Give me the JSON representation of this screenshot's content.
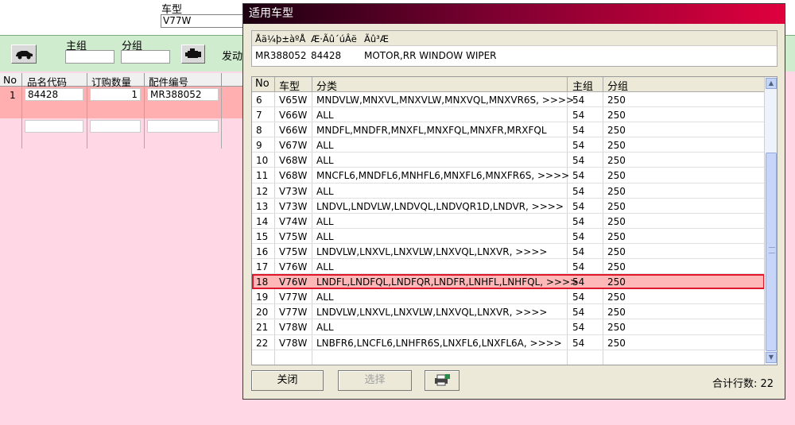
{
  "background": {
    "car_label": "车型",
    "car_value": "V77W",
    "main_group_label": "主组",
    "sub_group_label": "分组",
    "engine_label": "发动",
    "grid_headers": [
      "No",
      "品名代码",
      "订购数量",
      "配件编号"
    ],
    "grid_row": {
      "no": "1",
      "code": "84428",
      "qty": "1",
      "part": "MR388052"
    }
  },
  "window": {
    "title": "适用车型",
    "info_headers": [
      "Åä¼þ±àºÅ",
      "Æ·Ãû´úÂë",
      "Ãû³Æ"
    ],
    "info_values": [
      "MR388052",
      "84428",
      "MOTOR,RR WINDOW WIPER"
    ],
    "columns": [
      "No",
      "车型",
      "分类",
      "主组",
      "分组"
    ],
    "rows": [
      {
        "no": "6",
        "model": "V65W",
        "cls": "MNDVLW,MNXVL,MNXVLW,MNXVQL,MNXVR6S,  >>>>",
        "main": "54",
        "sub": "250"
      },
      {
        "no": "7",
        "model": "V66W",
        "cls": "ALL",
        "main": "54",
        "sub": "250"
      },
      {
        "no": "8",
        "model": "V66W",
        "cls": "MNDFL,MNDFR,MNXFL,MNXFQL,MNXFR,MRXFQL",
        "main": "54",
        "sub": "250"
      },
      {
        "no": "9",
        "model": "V67W",
        "cls": "ALL",
        "main": "54",
        "sub": "250"
      },
      {
        "no": "10",
        "model": "V68W",
        "cls": "ALL",
        "main": "54",
        "sub": "250"
      },
      {
        "no": "11",
        "model": "V68W",
        "cls": "MNCFL6,MNDFL6,MNHFL6,MNXFL6,MNXFR6S,  >>>>",
        "main": "54",
        "sub": "250"
      },
      {
        "no": "12",
        "model": "V73W",
        "cls": "ALL",
        "main": "54",
        "sub": "250"
      },
      {
        "no": "13",
        "model": "V73W",
        "cls": "LNDVL,LNDVLW,LNDVQL,LNDVQR1D,LNDVR,  >>>>",
        "main": "54",
        "sub": "250"
      },
      {
        "no": "14",
        "model": "V74W",
        "cls": "ALL",
        "main": "54",
        "sub": "250"
      },
      {
        "no": "15",
        "model": "V75W",
        "cls": "ALL",
        "main": "54",
        "sub": "250"
      },
      {
        "no": "16",
        "model": "V75W",
        "cls": "LNDVLW,LNXVL,LNXVLW,LNXVQL,LNXVR,  >>>>",
        "main": "54",
        "sub": "250"
      },
      {
        "no": "17",
        "model": "V76W",
        "cls": "ALL",
        "main": "54",
        "sub": "250"
      },
      {
        "no": "18",
        "model": "V76W",
        "cls": "LNDFL,LNDFQL,LNDFQR,LNDFR,LNHFL,LNHFQL,  >>>>",
        "main": "54",
        "sub": "250",
        "selected": true
      },
      {
        "no": "19",
        "model": "V77W",
        "cls": "ALL",
        "main": "54",
        "sub": "250"
      },
      {
        "no": "20",
        "model": "V77W",
        "cls": "LNDVLW,LNXVL,LNXVLW,LNXVQL,LNXVR,  >>>>",
        "main": "54",
        "sub": "250"
      },
      {
        "no": "21",
        "model": "V78W",
        "cls": "ALL",
        "main": "54",
        "sub": "250"
      },
      {
        "no": "22",
        "model": "V78W",
        "cls": "LNBFR6,LNCFL6,LNHFR6S,LNXFL6,LNXFL6A,  >>>>",
        "main": "54",
        "sub": "250"
      }
    ],
    "close_label": "关闭",
    "select_label": "选择",
    "total_label": "合计行数: 22"
  }
}
